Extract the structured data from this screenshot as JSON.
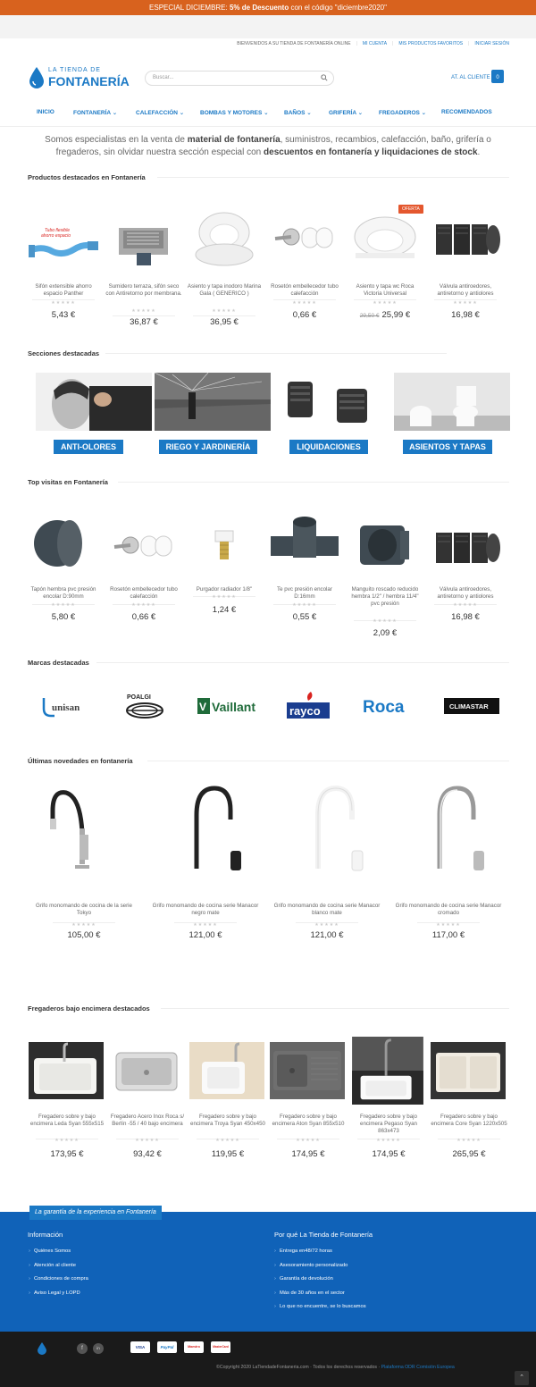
{
  "promo": {
    "prefix": "ESPECIAL DICIEMBRE: ",
    "highlight": "5% de Descuento",
    "suffix": " con el código \"diciembre2020\""
  },
  "toplinks": {
    "welcome": "BIENVENIDOS A SU TIENDA DE FONTANERÍA ONLINE",
    "account": "MI CUENTA",
    "favorites": "MIS PRODUCTOS FAVORITOS",
    "login": "INICIAR SESIÓN"
  },
  "logo": {
    "line1": "LA TIENDA DE",
    "line2": "FONTANERÍA"
  },
  "search": {
    "placeholder": "Buscar..."
  },
  "header": {
    "customer_service": "AT. AL CLIENTE",
    "cart_count": "0"
  },
  "nav": [
    "INICIO",
    "FONTANERÍA ⌄",
    "CALEFACCIÓN ⌄",
    "BOMBAS Y MOTORES ⌄",
    "BAÑOS ⌄",
    "GRIFERÍA ⌄",
    "FREGADEROS ⌄",
    "RECOMENDADOS"
  ],
  "intro": {
    "p1": "Somos especialistas en la venta de ",
    "b1": "material de fontanería",
    "p2": ", suministros, recambios, calefacción, baño, grifería o fregaderos, sin olvidar nuestra sección especial con ",
    "b2": "descuentos en fontanería y liquidaciones de stock",
    "p3": "."
  },
  "featured": {
    "title": "Productos destacados en Fontanería",
    "oferta": "OFERTA",
    "products": [
      {
        "name": "Sifón extensible ahorro espacio Panther",
        "price": "5,43 €",
        "img_label": "Tubo flexible ahorro espacio"
      },
      {
        "name": "Sumidero terraza, sifón seco con Antiretorno por membrana.",
        "price": "36,87 €"
      },
      {
        "name": "Asiento y tapa inodoro Marina Gala ( GENERICO )",
        "price": "36,95 €"
      },
      {
        "name": "Rosetón embellecedor tubo calefacción",
        "price": "0,66 €"
      },
      {
        "name": "Asiento y tapa wc Roca Victoria Universal",
        "price": "25,99 €",
        "old_price": "29,50 €"
      },
      {
        "name": "Válvula antiroedores, antiretorno y antiolores",
        "price": "16,98 €"
      }
    ]
  },
  "sections": {
    "title": "Secciones destacadas",
    "items": [
      "ANTI-OLORES",
      "RIEGO Y JARDINERÍA",
      "LIQUIDACIONES",
      "ASIENTOS Y TAPAS"
    ]
  },
  "top": {
    "title": "Top visitas en Fontanería",
    "products": [
      {
        "name": "Tapón hembra pvc presión encolar D:90mm",
        "price": "5,80 €"
      },
      {
        "name": "Rosetón embellecedor tubo calefacción",
        "price": "0,66 €"
      },
      {
        "name": "Purgador radiador 1/8\"",
        "price": "1,24 €"
      },
      {
        "name": "Te pvc presión encolar D:16mm",
        "price": "0,55 €"
      },
      {
        "name": "Manguito roscado reducido hembra 1/2\" / hembra 11/4\" pvc presión",
        "price": "2,09 €"
      },
      {
        "name": "Válvula antiroedores, antiretorno y antiolores",
        "price": "16,98 €"
      }
    ]
  },
  "brands": {
    "title": "Marcas destacadas",
    "items": [
      "unisan",
      "POALGI",
      "Vaillant",
      "rayco",
      "Roca",
      "CLIMASTAR"
    ]
  },
  "news": {
    "title": "Últimas novedades en fontanería",
    "products": [
      {
        "name": "Grifo monomando de cocina de la serie Tokyo",
        "price": "105,00 €"
      },
      {
        "name": "Grifo monomando de cocina serie Manacor negro mate",
        "price": "121,00 €"
      },
      {
        "name": "Grifo monomando de cocina serie Manacor blanco mate",
        "price": "121,00 €"
      },
      {
        "name": "Grifo monomando de cocina serie Manacor cromado",
        "price": "117,00 €"
      }
    ]
  },
  "sinks": {
    "title": "Fregaderos bajo encimera destacados",
    "products": [
      {
        "name": "Fregadero sobre y bajo encimera Leda Syan 555x515",
        "price": "173,95 €"
      },
      {
        "name": "Fregadero Acero Inox Roca s/ Berlín -55 / 40 bajo encimera",
        "price": "93,42 €"
      },
      {
        "name": "Fregadero sobre y bajo encimera Troya Syan 450x450",
        "price": "119,95 €"
      },
      {
        "name": "Fregadero sobre y bajo encimera Aton Syan 855x510",
        "price": "174,95 €"
      },
      {
        "name": "Fregadero sobre y bajo encimera Pegaso Syan 863x473",
        "price": "174,95 €"
      },
      {
        "name": "Fregadero sobre y bajo encimera Core Syan 1220x505",
        "price": "265,95 €"
      }
    ]
  },
  "footer": {
    "band": "La garantía de la experiencia en Fontanería",
    "info_title": "Información",
    "info_links": [
      "Quiénes Somos",
      "Atención al cliente",
      "Condiciones de compra",
      "Aviso Legal y LOPD"
    ],
    "why_title": "Por qué La Tienda de Fontanería",
    "why_items": [
      "Entrega en48/72 horas",
      "Asesoramiento personalizado",
      "Garantía de devolución",
      "Más de 30 años en el sector",
      "Lo que no encuentre, se lo buscamos"
    ],
    "payments": [
      "VISA",
      "PayPal",
      "Maestro",
      "MasterCard"
    ],
    "social": [
      "f",
      "in"
    ],
    "copyright": "©Copyright 2020 LaTiendadeFontaneria.com · Todos los derechos reservados · ",
    "platform": "Plataforma ODR Comisión Europea",
    "to_top": "⌃"
  },
  "colors": {
    "brand": "#1b79c5",
    "promo": "#d8621e",
    "footer": "#1062b8",
    "oferta": "#e4572e"
  }
}
